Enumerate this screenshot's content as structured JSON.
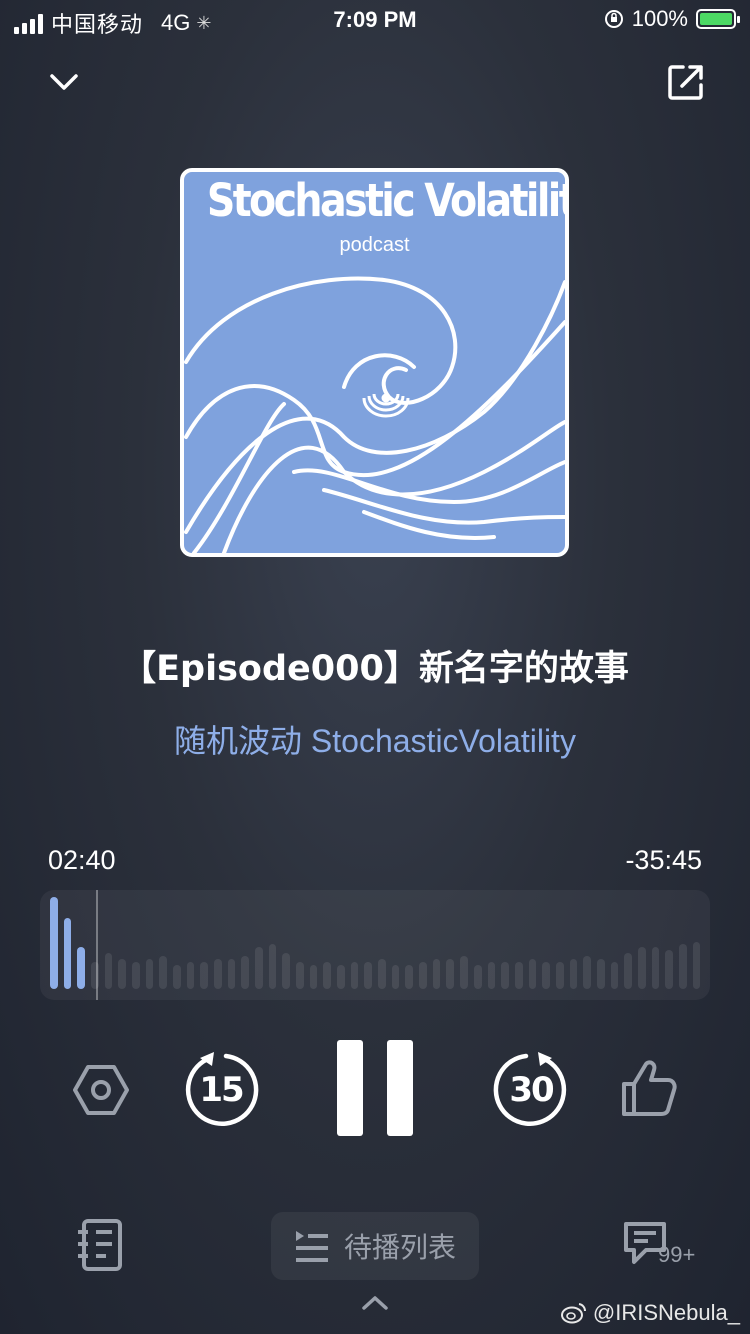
{
  "status_bar": {
    "carrier": "中国移动",
    "network": "4G",
    "time": "7:09 PM",
    "battery_percent": "100%",
    "battery_color": "#4cd964",
    "icons": [
      "signal-icon",
      "loading-spinner-icon",
      "orientation-lock-icon",
      "battery-charging-icon"
    ]
  },
  "header": {
    "collapse_icon": "chevron-down-icon",
    "share_icon": "share-external-icon"
  },
  "cover": {
    "title": "Stochastic Volatility",
    "subtitle": "podcast",
    "background_color": "#7fa2dd",
    "art": "wave-artwork"
  },
  "episode": {
    "title": "【Episode000】新名字的故事",
    "podcast_name": "随机波动 StochasticVolatility",
    "podcast_name_color": "#8eaee8"
  },
  "player": {
    "elapsed": "02:40",
    "remaining": "-35:45",
    "progress_fraction": 0.07,
    "waveform_played_color": "#8eaee8",
    "skip_back_seconds": "15",
    "skip_forward_seconds": "30",
    "state": "playing",
    "controls": [
      "speed-hexagon-icon",
      "rewind-15-icon",
      "pause-icon",
      "forward-30-icon",
      "thumbs-up-icon"
    ]
  },
  "bottom_bar": {
    "notes_icon": "notebook-icon",
    "queue_icon": "playlist-icon",
    "queue_label": "待播列表",
    "comments_icon": "comment-icon",
    "comments_badge": "99+",
    "expand_icon": "chevron-up-icon"
  },
  "watermark": {
    "text": "@IRISNebula_",
    "icon": "weibo-icon"
  }
}
